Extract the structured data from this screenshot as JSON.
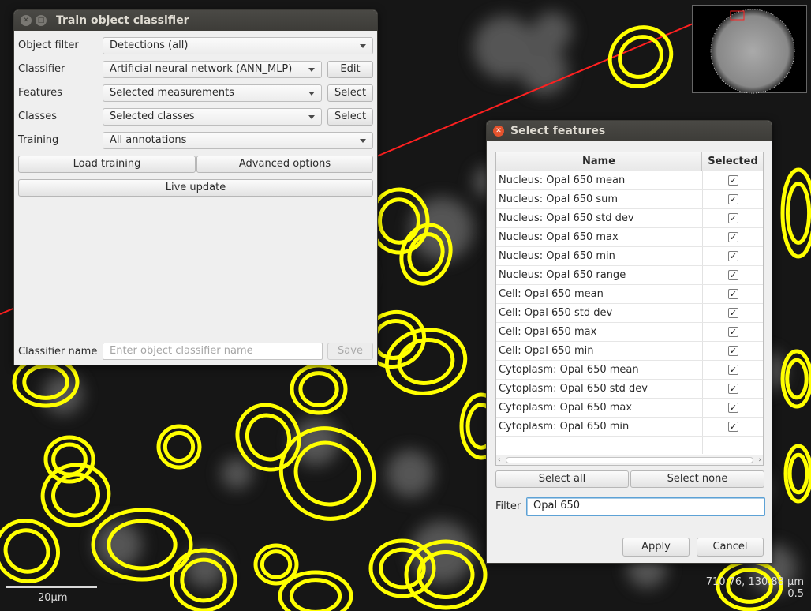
{
  "train_window": {
    "title": "Train object classifier",
    "rows": [
      {
        "label": "Object filter",
        "value": "Detections (all)",
        "button": ""
      },
      {
        "label": "Classifier",
        "value": "Artificial neural network (ANN_MLP)",
        "button": "Edit"
      },
      {
        "label": "Features",
        "value": "Selected measurements",
        "button": "Select"
      },
      {
        "label": "Classes",
        "value": "Selected classes",
        "button": "Select"
      },
      {
        "label": "Training",
        "value": "All annotations",
        "button": ""
      }
    ],
    "load_training": "Load training",
    "advanced_options": "Advanced options",
    "live_update": "Live update",
    "classifier_name_label": "Classifier name",
    "classifier_name_placeholder": "Enter object classifier name",
    "save": "Save"
  },
  "features_window": {
    "title": "Select features",
    "columns": {
      "name": "Name",
      "selected": "Selected"
    },
    "rows": [
      {
        "name": "Nucleus: Opal 650 mean",
        "selected": true
      },
      {
        "name": "Nucleus: Opal 650 sum",
        "selected": true
      },
      {
        "name": "Nucleus: Opal 650 std dev",
        "selected": true
      },
      {
        "name": "Nucleus: Opal 650 max",
        "selected": true
      },
      {
        "name": "Nucleus: Opal 650 min",
        "selected": true
      },
      {
        "name": "Nucleus: Opal 650 range",
        "selected": true
      },
      {
        "name": "Cell: Opal 650 mean",
        "selected": true
      },
      {
        "name": "Cell: Opal 650 std dev",
        "selected": true
      },
      {
        "name": "Cell: Opal 650 max",
        "selected": true
      },
      {
        "name": "Cell: Opal 650 min",
        "selected": true
      },
      {
        "name": "Cytoplasm: Opal 650 mean",
        "selected": true
      },
      {
        "name": "Cytoplasm: Opal 650 std dev",
        "selected": true
      },
      {
        "name": "Cytoplasm: Opal 650 max",
        "selected": true
      },
      {
        "name": "Cytoplasm: Opal 650 min",
        "selected": true
      }
    ],
    "select_all": "Select all",
    "select_none": "Select none",
    "filter_label": "Filter",
    "filter_value": "Opal 650",
    "apply": "Apply",
    "cancel": "Cancel"
  },
  "viewer": {
    "scalebar": "20µm",
    "cursor_coords": "710.76, 130.88 µm",
    "pixel_value": "0.5",
    "annotation_color": "#ffff00",
    "line_color": "#ff2020"
  }
}
